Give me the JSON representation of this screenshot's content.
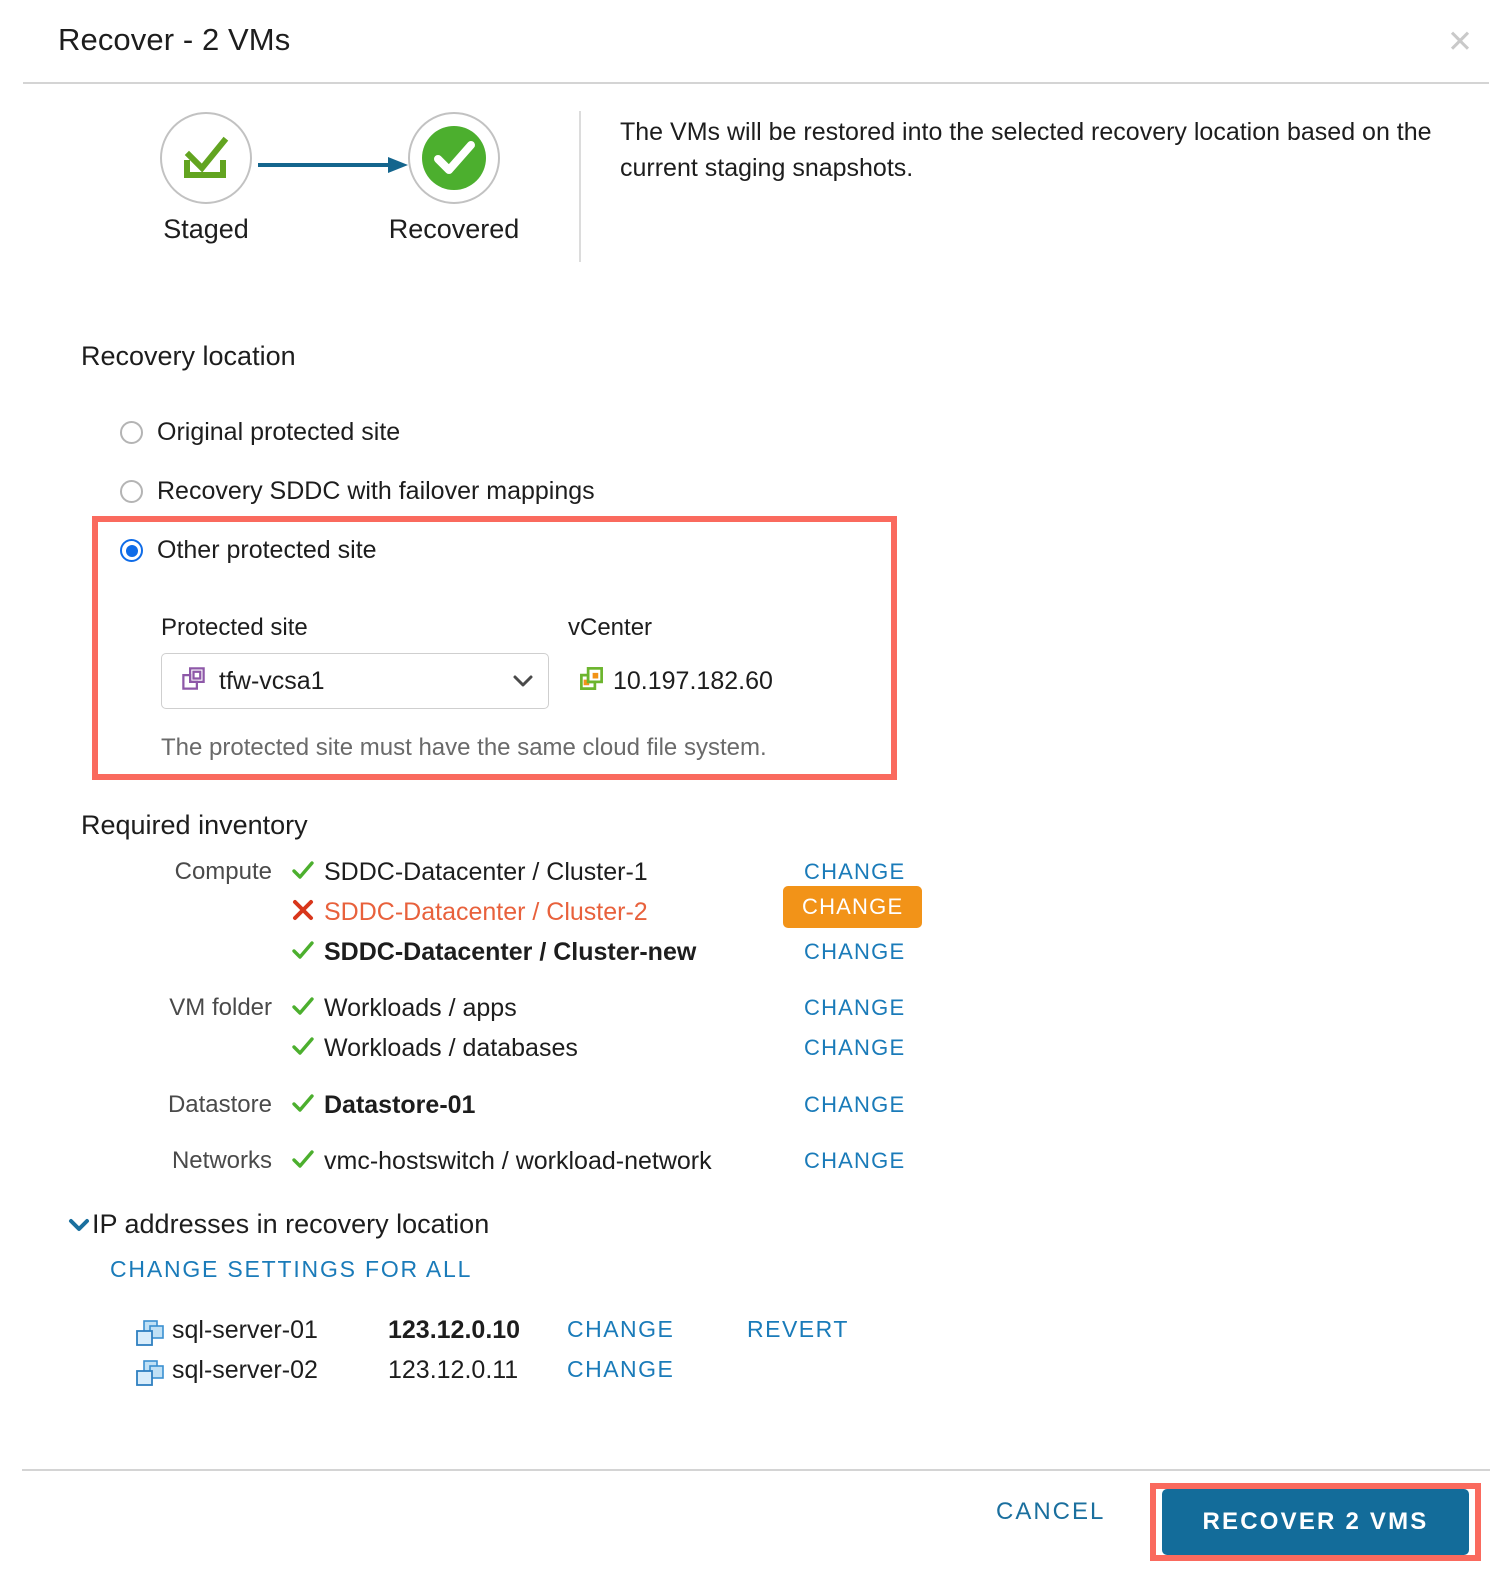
{
  "header": {
    "title": "Recover - 2 VMs",
    "close_icon": "close-icon"
  },
  "flow": {
    "nodes": [
      {
        "label": "Staged",
        "icon": "staged-check-icon",
        "state": "outline"
      },
      {
        "label": "Recovered",
        "icon": "recovered-check-icon",
        "state": "filled-green"
      }
    ],
    "arrow_icon": "arrow-right-icon",
    "description": "The VMs will be restored into the selected recovery location based on the current staging snapshots."
  },
  "recovery_location": {
    "heading": "Recovery location",
    "options": [
      {
        "label": "Original protected site",
        "selected": false
      },
      {
        "label": "Recovery SDDC with failover mappings",
        "selected": false
      },
      {
        "label": "Other protected site",
        "selected": true
      }
    ],
    "protected_site": {
      "label": "Protected site",
      "value": "tfw-vcsa1",
      "icon": "vcenter-purple-icon",
      "chevron_icon": "chevron-down-icon"
    },
    "vcenter": {
      "label": "vCenter",
      "value": "10.197.182.60",
      "icon": "vcenter-green-icon"
    },
    "hint": "The protected site must have the same cloud file system."
  },
  "required_inventory": {
    "heading": "Required inventory",
    "rows": [
      {
        "category": "Compute",
        "status": "ok",
        "name": "SDDC-Datacenter / Cluster-1",
        "bold": false,
        "action": "CHANGE",
        "action_style": "link"
      },
      {
        "category": "",
        "status": "error",
        "name": "SDDC-Datacenter / Cluster-2",
        "bold": false,
        "action": "CHANGE",
        "action_style": "warning"
      },
      {
        "category": "",
        "status": "ok",
        "name": "SDDC-Datacenter / Cluster-new",
        "bold": true,
        "action": "CHANGE",
        "action_style": "link"
      },
      {
        "category": "VM folder",
        "status": "ok",
        "name": "Workloads / apps",
        "bold": false,
        "action": "CHANGE",
        "action_style": "link"
      },
      {
        "category": "",
        "status": "ok",
        "name": "Workloads / databases",
        "bold": false,
        "action": "CHANGE",
        "action_style": "link"
      },
      {
        "category": "Datastore",
        "status": "ok",
        "name": "Datastore-01",
        "bold": true,
        "action": "CHANGE",
        "action_style": "link"
      },
      {
        "category": "Networks",
        "status": "ok",
        "name": "vmc-hostswitch / workload-network",
        "bold": false,
        "action": "CHANGE",
        "action_style": "link"
      }
    ]
  },
  "ip_addresses": {
    "heading": "IP addresses in recovery location",
    "expanded": true,
    "chevron_icon": "chevron-down-icon",
    "change_all_label": "CHANGE SETTINGS FOR ALL",
    "rows": [
      {
        "icon": "vm-icon",
        "vm": "sql-server-01",
        "ip": "123.12.0.10",
        "ip_bold": true,
        "change": "CHANGE",
        "revert": "REVERT"
      },
      {
        "icon": "vm-icon",
        "vm": "sql-server-02",
        "ip": "123.12.0.11",
        "ip_bold": false,
        "change": "CHANGE",
        "revert": ""
      }
    ]
  },
  "footer": {
    "cancel_label": "CANCEL",
    "primary_label": "RECOVER 2 VMS"
  },
  "colors": {
    "accent_blue": "#136c9a",
    "link_blue": "#1a7bb9",
    "radio_blue": "#0f6ce8",
    "success_green": "#4caf2e",
    "error_orange": "#e8613c",
    "warning_orange": "#f29318",
    "highlight_red": "#fa6a5e",
    "divider_gray": "#d4d4d4"
  }
}
